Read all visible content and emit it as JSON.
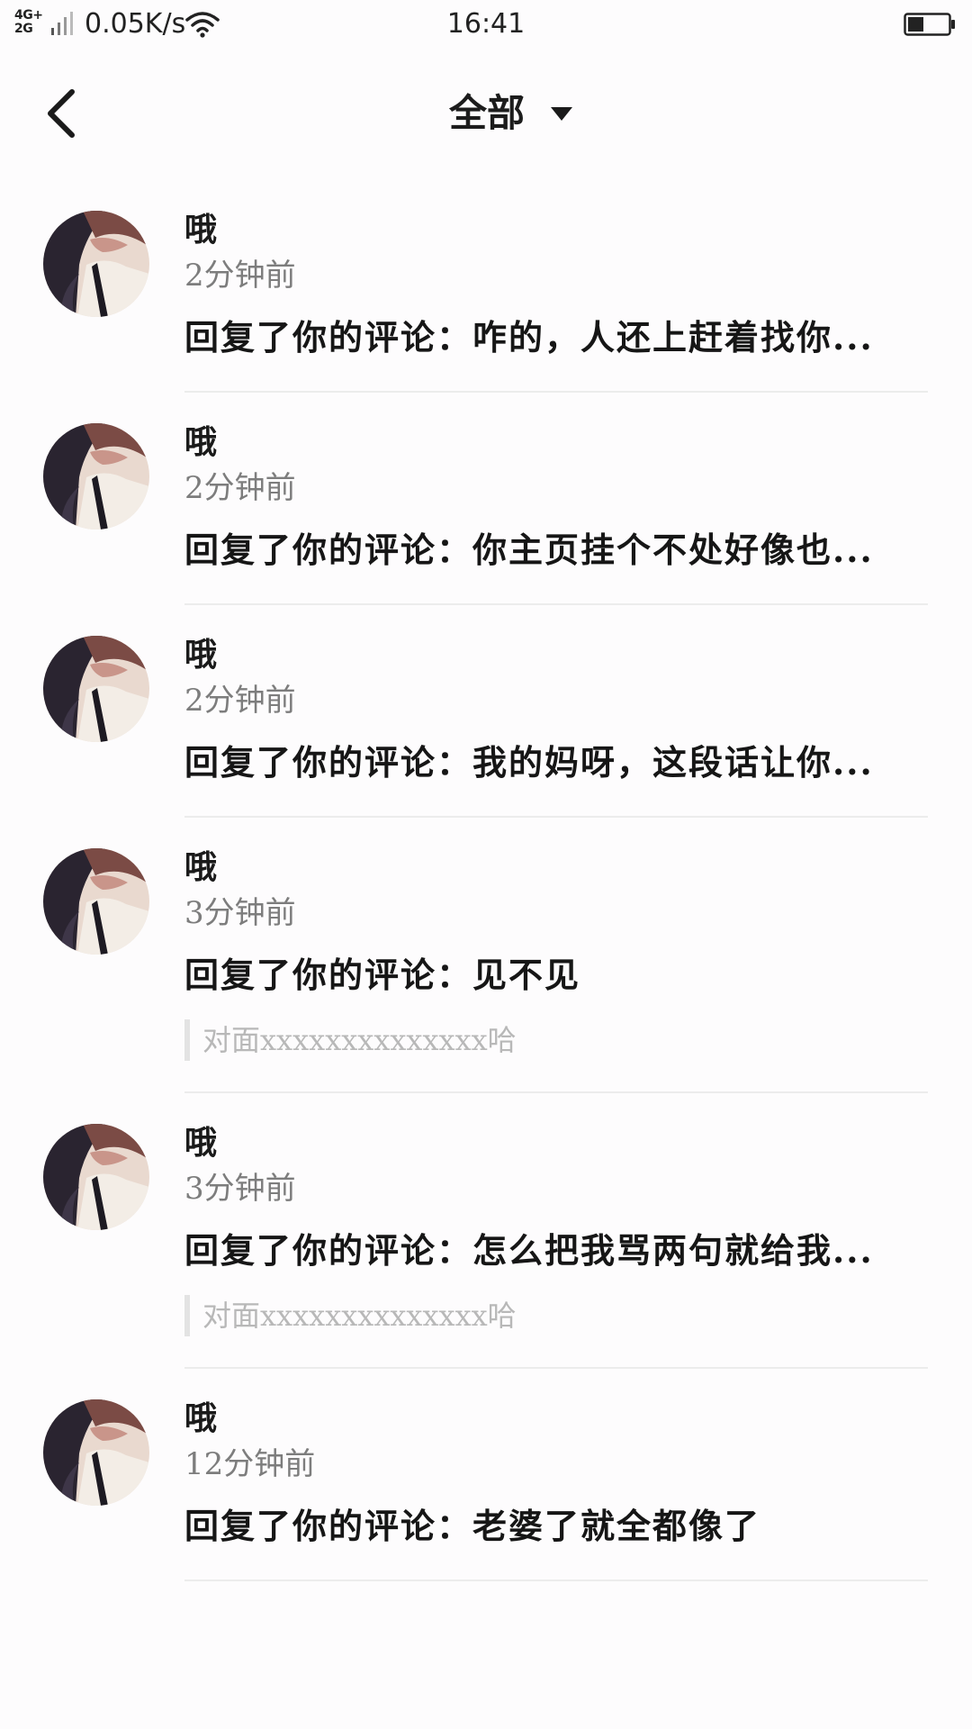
{
  "status_bar": {
    "network_top": "4G+",
    "network_bottom": "2G",
    "speed": "0.05K/s",
    "time": "16:41",
    "icons": [
      "signal-icon",
      "wifi-icon",
      "battery-icon"
    ]
  },
  "nav": {
    "back_icon": "chevron-left-icon",
    "title": "全部",
    "dropdown_icon": "caret-down-icon"
  },
  "notifications": [
    {
      "name": "哦",
      "time": "2分钟前",
      "text": "回复了你的评论：咋的，人还上赶着找你..."
    },
    {
      "name": "哦",
      "time": "2分钟前",
      "text": "回复了你的评论：你主页挂个不处好像也..."
    },
    {
      "name": "哦",
      "time": "2分钟前",
      "text": "回复了你的评论：我的妈呀，这段话让你..."
    },
    {
      "name": "哦",
      "time": "3分钟前",
      "text": "回复了你的评论：见不见",
      "quote": "对面xxxxxxxxxxxxxx哈"
    },
    {
      "name": "哦",
      "time": "3分钟前",
      "text": "回复了你的评论：怎么把我骂两句就给我...",
      "quote": "对面xxxxxxxxxxxxxx哈"
    },
    {
      "name": "哦",
      "time": "12分钟前",
      "text": "回复了你的评论：老婆了就全都像了"
    }
  ],
  "colors": {
    "background": "#fdfcfd",
    "divider": "#ececec",
    "secondary_text": "#7d7d7d",
    "quote_text": "#b8b8b8"
  }
}
